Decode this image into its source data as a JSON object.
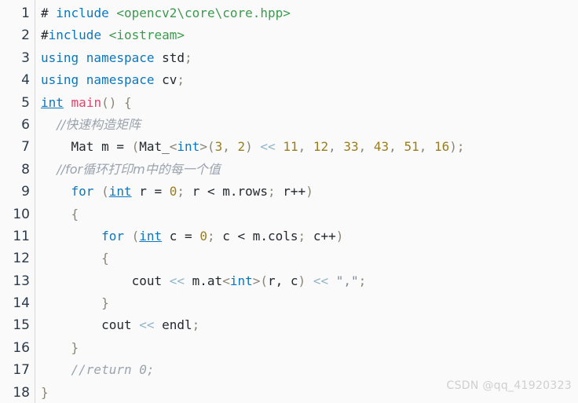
{
  "editor": {
    "background_color": "#fafafa",
    "gutter_divider_color": "#d7d7d7",
    "line_number_color": "#2b3a4a",
    "language": "C++",
    "total_lines": 18
  },
  "colors": {
    "keyword": "#0b77be",
    "function": "#e8416b",
    "string_include": "#3c9a4e",
    "string_literal": "#7f8c99",
    "number": "#9a7d1e",
    "punctuation": "#8a8577",
    "operator": "#8fb5c9",
    "plain": "#24292e",
    "comment": "#9aa3ad",
    "watermark": "#cfcfcf"
  },
  "line_numbers": [
    "1",
    "2",
    "3",
    "4",
    "5",
    "6",
    "7",
    "8",
    "9",
    "10",
    "11",
    "12",
    "13",
    "14",
    "15",
    "16",
    "17",
    "18"
  ],
  "code_lines": [
    {
      "number": "1",
      "text": "# include <opencv2\\core\\core.hpp>"
    },
    {
      "number": "2",
      "text": "#include <iostream>"
    },
    {
      "number": "3",
      "text": "using namespace std;"
    },
    {
      "number": "4",
      "text": "using namespace cv;"
    },
    {
      "number": "5",
      "text": "int main() {"
    },
    {
      "number": "6",
      "text": "    //快速构造矩阵"
    },
    {
      "number": "7",
      "text": "    Mat m = (Mat_<int>(3, 2) << 11, 12, 33, 43, 51, 16);"
    },
    {
      "number": "8",
      "text": "    //for循环打印m中的每一个值"
    },
    {
      "number": "9",
      "text": "    for (int r = 0; r < m.rows; r++)"
    },
    {
      "number": "10",
      "text": "    {"
    },
    {
      "number": "11",
      "text": "        for (int c = 0; c < m.cols; c++)"
    },
    {
      "number": "12",
      "text": "        {"
    },
    {
      "number": "13",
      "text": "            cout << m.at<int>(r, c) << \",\";"
    },
    {
      "number": "14",
      "text": "        }"
    },
    {
      "number": "15",
      "text": "        cout << endl;"
    },
    {
      "number": "16",
      "text": "    }"
    },
    {
      "number": "17",
      "text": "    //return 0;"
    },
    {
      "number": "18",
      "text": "}"
    }
  ],
  "tokens": {
    "l1": {
      "hash": "#",
      "include": " include ",
      "path": "<opencv2\\core\\core.hpp>"
    },
    "l2": {
      "hash": "#",
      "include": "include",
      "path": " <iostream>"
    },
    "l3": {
      "using": "using namespace ",
      "name": "std",
      "semi": ";"
    },
    "l4": {
      "using": "using namespace ",
      "name": "cv",
      "semi": ";"
    },
    "l5": {
      "int": "int",
      "space": " ",
      "main": "main",
      "parens": "()",
      "brace": " {"
    },
    "l6": {
      "comment": "    //快速构造矩阵"
    },
    "l7": {
      "indent": "    ",
      "mat": "Mat m = ",
      "p1": "(",
      "mat_": "Mat_",
      "lt": "<",
      "int": "int",
      "gt": ">",
      "p2": "(",
      "n3": "3",
      "comma1": ", ",
      "n2": "2",
      "p3": ")",
      "shift": " << ",
      "n11": "11",
      "c1": ", ",
      "n12": "12",
      "c2": ", ",
      "n33": "33",
      "c3": ", ",
      "n43": "43",
      "c4": ", ",
      "n51": "51",
      "c5": ", ",
      "n16": "16",
      "p4": ")",
      "semi": ";"
    },
    "l8": {
      "comment": "    //for循环打印m中的每一个值"
    },
    "l9": {
      "indent": "    ",
      "for": "for ",
      "p1": "(",
      "int": "int",
      "var": " r = ",
      "zero": "0",
      "semi1": "; ",
      "cond": "r < m.rows",
      "semi2": "; ",
      "incr": "r++",
      "p2": ")"
    },
    "l10": {
      "text": "    {"
    },
    "l11": {
      "indent": "        ",
      "for": "for ",
      "p1": "(",
      "int": "int",
      "var": " c = ",
      "zero": "0",
      "semi1": "; ",
      "cond": "c < m.cols",
      "semi2": "; ",
      "incr": "c++",
      "p2": ")"
    },
    "l12": {
      "text": "        {"
    },
    "l13": {
      "indent": "            ",
      "cout": "cout",
      "shift1": " << ",
      "mat": "m.at",
      "lt": "<",
      "int": "int",
      "gt": ">",
      "p1": "(",
      "args": "r, c",
      "p2": ")",
      "shift2": " << ",
      "str": "\",\"",
      "semi": ";"
    },
    "l14": {
      "text": "        }"
    },
    "l15": {
      "indent": "        ",
      "cout": "cout",
      "shift": " << ",
      "endl": "endl",
      "semi": ";"
    },
    "l16": {
      "text": "    }"
    },
    "l17": {
      "comment": "    //return 0;"
    },
    "l18": {
      "text": "}"
    }
  },
  "watermark": {
    "text": "CSDN @qq_41920323"
  }
}
